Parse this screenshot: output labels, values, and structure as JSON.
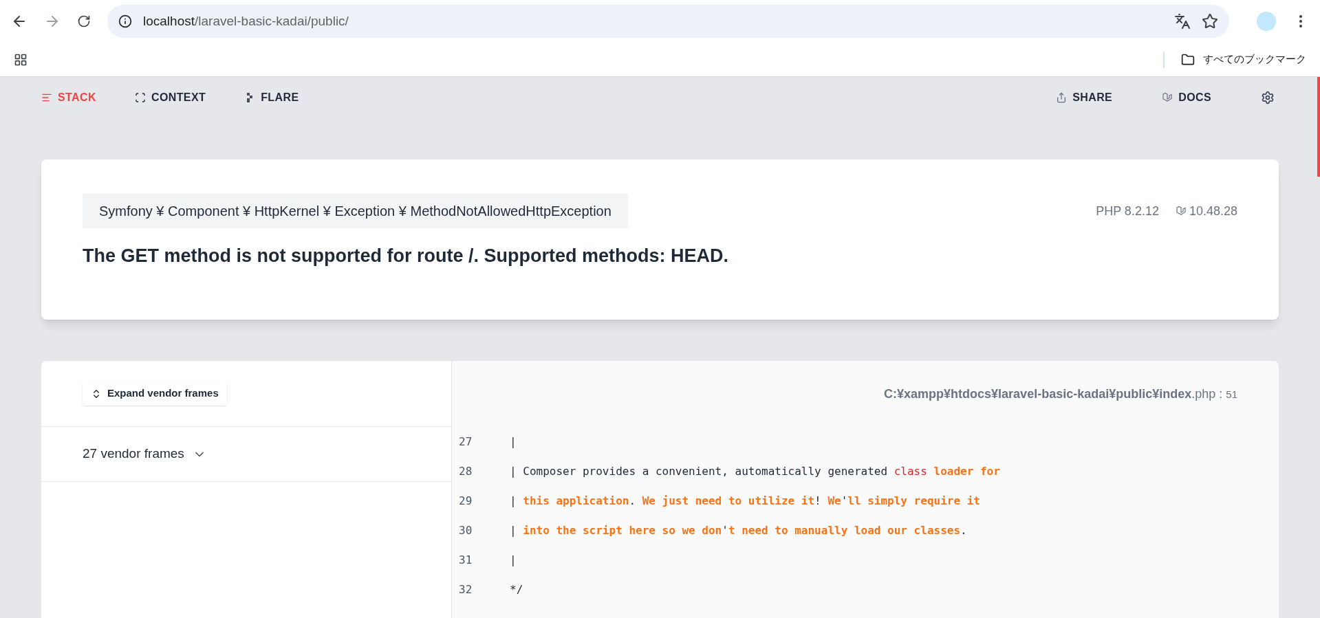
{
  "browser": {
    "url_host": "localhost",
    "url_path": "/laravel-basic-kadai/public/",
    "bookmarks_label": "すべてのブックマーク"
  },
  "nav": {
    "left": [
      {
        "label": "STACK",
        "selected": true
      },
      {
        "label": "CONTEXT",
        "selected": false
      },
      {
        "label": "FLARE",
        "selected": false
      }
    ],
    "right": [
      {
        "label": "SHARE"
      },
      {
        "label": "DOCS"
      }
    ]
  },
  "exception": {
    "class": "Symfony ¥ Component ¥ HttpKernel ¥ Exception ¥ MethodNotAllowedHttpException",
    "php_version": "PHP 8.2.12",
    "laravel_version": "10.48.28",
    "message": "The GET method is not supported for route /. Supported methods: HEAD."
  },
  "frames": {
    "expand_button": "Expand vendor frames",
    "vendor_group": "27 vendor frames"
  },
  "source": {
    "file_path": "C:¥xampp¥htdocs¥laravel-basic-kadai¥public¥index",
    "file_ext": ".php",
    "separator": ":",
    "line": "51",
    "lines": [
      {
        "number": "27",
        "tokens": [
          {
            "kind": "plain",
            "text": "|"
          }
        ]
      },
      {
        "number": "28",
        "tokens": [
          {
            "kind": "plain",
            "text": "| Composer provides a convenient, automatically generated "
          },
          {
            "kind": "keyword",
            "text": "class"
          },
          {
            "kind": "string",
            "text": " loader for"
          }
        ]
      },
      {
        "number": "29",
        "tokens": [
          {
            "kind": "plain",
            "text": "| "
          },
          {
            "kind": "string",
            "text": "this application"
          },
          {
            "kind": "plain",
            "text": ". "
          },
          {
            "kind": "string",
            "text": "We just need to utilize it"
          },
          {
            "kind": "plain",
            "text": "! "
          },
          {
            "kind": "string",
            "text": "We"
          },
          {
            "kind": "plain",
            "text": "'"
          },
          {
            "kind": "string",
            "text": "ll simply require it"
          }
        ]
      },
      {
        "number": "30",
        "tokens": [
          {
            "kind": "plain",
            "text": "| "
          },
          {
            "kind": "string",
            "text": "into the script here so we don"
          },
          {
            "kind": "plain",
            "text": "'"
          },
          {
            "kind": "string",
            "text": "t need to manually load our classes"
          },
          {
            "kind": "plain",
            "text": "."
          }
        ]
      },
      {
        "number": "31",
        "tokens": [
          {
            "kind": "plain",
            "text": "|"
          }
        ]
      },
      {
        "number": "32",
        "tokens": [
          {
            "kind": "plain",
            "text": "*/"
          }
        ]
      }
    ]
  }
}
